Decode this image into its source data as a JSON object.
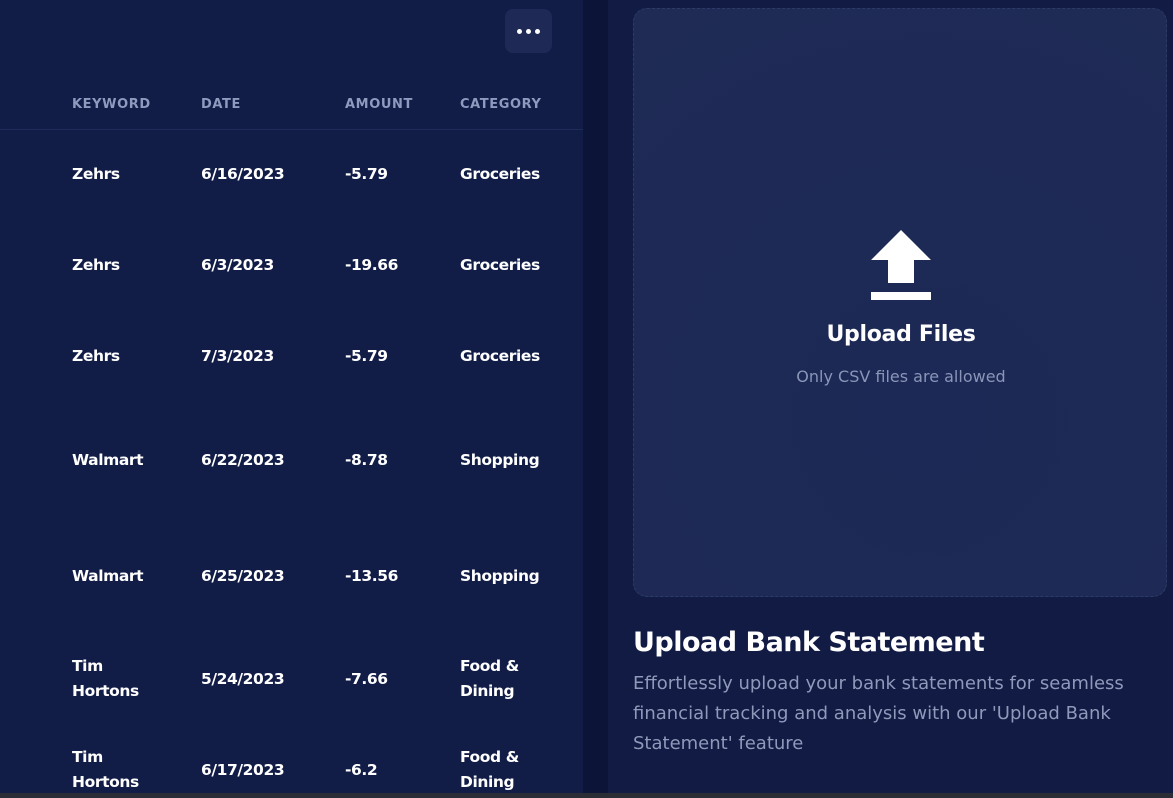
{
  "table": {
    "columns": {
      "keyword": "KEYWORD",
      "date": "DATE",
      "amount": "AMOUNT",
      "category": "CATEGORY"
    },
    "rows": [
      {
        "keyword": [
          "Zehrs"
        ],
        "date": "6/16/2023",
        "amount": "-5.79",
        "category": [
          "Groceries"
        ]
      },
      {
        "keyword": [
          "Zehrs"
        ],
        "date": "6/3/2023",
        "amount": "-19.66",
        "category": [
          "Groceries"
        ]
      },
      {
        "keyword": [
          "Zehrs"
        ],
        "date": "7/3/2023",
        "amount": "-5.79",
        "category": [
          "Groceries"
        ]
      },
      {
        "keyword": [
          "Walmart"
        ],
        "date": "6/22/2023",
        "amount": "-8.78",
        "category": [
          "Shopping"
        ]
      },
      {
        "keyword": [
          "Walmart"
        ],
        "date": "6/25/2023",
        "amount": "-13.56",
        "category": [
          "Shopping"
        ]
      },
      {
        "keyword": [
          "Tim",
          "Hortons"
        ],
        "date": "5/24/2023",
        "amount": "-7.66",
        "category": [
          "Food &",
          "Dining"
        ]
      },
      {
        "keyword": [
          "Tim",
          "Hortons"
        ],
        "date": "6/17/2023",
        "amount": "-6.2",
        "category": [
          "Food &",
          "Dining"
        ]
      }
    ]
  },
  "toolbar": {
    "more_icon": "more-horizontal-icon"
  },
  "upload": {
    "icon": "upload-icon",
    "title": "Upload Files",
    "subtitle": "Only CSV files are allowed"
  },
  "section": {
    "title": "Upload Bank Statement",
    "description": "Effortlessly upload your bank statements for seamless financial tracking and analysis with our 'Upload Bank Statement' feature"
  }
}
